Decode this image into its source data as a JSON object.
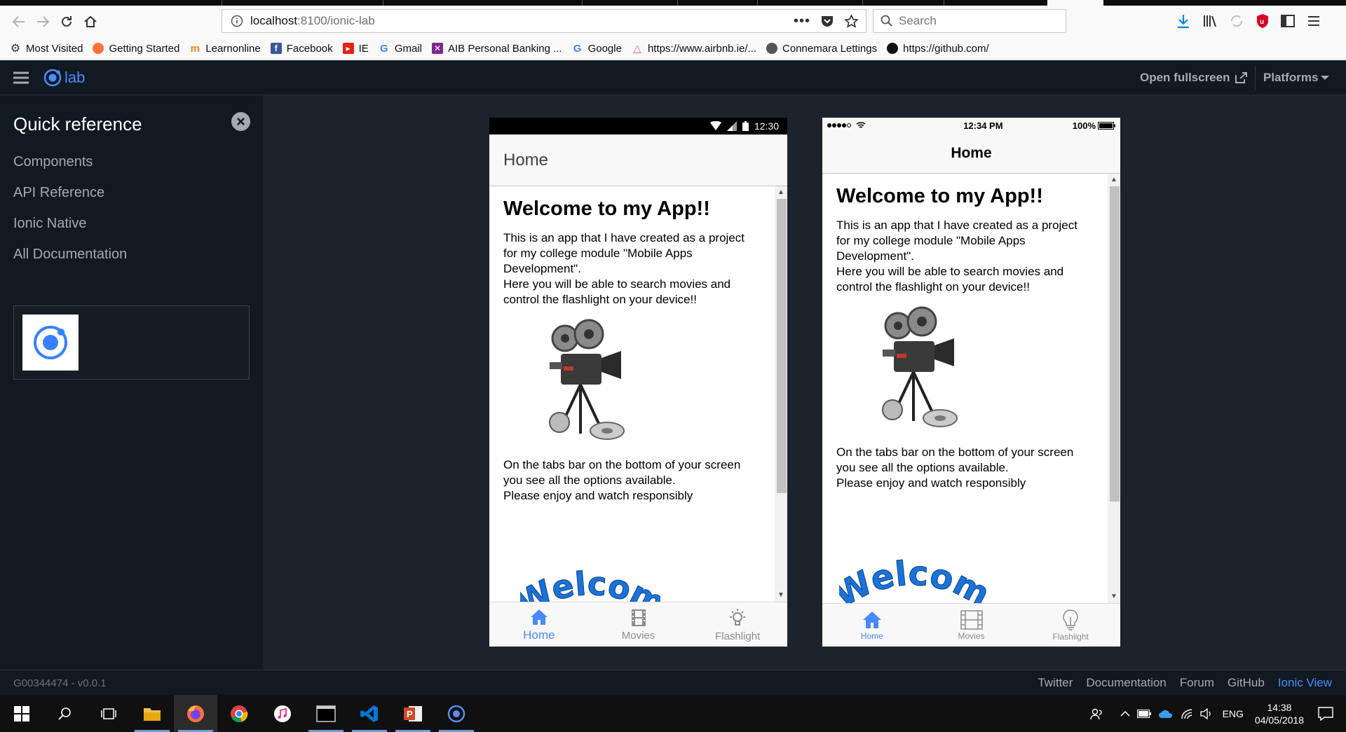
{
  "browser": {
    "url_host": "localhost",
    "url_path": ":8100/ionic-lab",
    "search_placeholder": "Search",
    "bookmarks": [
      {
        "label": "Most Visited",
        "icon": "gear-icon"
      },
      {
        "label": "Getting Started",
        "icon": "firefox-icon"
      },
      {
        "label": "Learnonline",
        "icon": "moodle-icon"
      },
      {
        "label": "Facebook",
        "icon": "facebook-icon"
      },
      {
        "label": "IE",
        "icon": "youtube-icon"
      },
      {
        "label": "Gmail",
        "icon": "google-icon"
      },
      {
        "label": "AIB Personal Banking ...",
        "icon": "aib-icon"
      },
      {
        "label": "Google",
        "icon": "google-icon"
      },
      {
        "label": "https://www.airbnb.ie/...",
        "icon": "airbnb-icon"
      },
      {
        "label": "Connemara Lettings",
        "icon": "globe-icon"
      },
      {
        "label": "https://github.com/",
        "icon": "github-icon"
      }
    ]
  },
  "lab": {
    "logo_text": "lab",
    "open_fullscreen": "Open fullscreen",
    "platforms": "Platforms",
    "accent": "#4d8dff"
  },
  "sidebar": {
    "title": "Quick reference",
    "links": [
      "Components",
      "API Reference",
      "Ionic Native",
      "All Documentation"
    ]
  },
  "footer": {
    "version": "G00344474 - v0.0.1",
    "links": [
      "Twitter",
      "Documentation",
      "Forum",
      "GitHub",
      "Ionic View"
    ]
  },
  "app": {
    "page_title": "Home",
    "heading": "Welcome to my App!!",
    "intro_lines": [
      "This is an app that I have created as a project for my college module \"Mobile Apps Development\".",
      "Here you will be able to search movies and control the flashlight on your device!!"
    ],
    "outro_lines": [
      "On the tabs bar on the bottom of your screen you see all the options available.",
      "Please enjoy and watch responsibly"
    ],
    "welcome_art_text": "Welcome",
    "tabs": [
      {
        "label": "Home",
        "icon": "home-icon"
      },
      {
        "label": "Movies",
        "icon": "film-icon"
      },
      {
        "label": "Flashlight",
        "icon": "bulb-icon"
      }
    ],
    "tab_active_color": "#488aff"
  },
  "android": {
    "time": "12:30"
  },
  "ios": {
    "time": "12:34 PM",
    "battery": "100%"
  },
  "taskbar": {
    "language": "ENG",
    "time": "14:38",
    "date": "04/05/2018"
  }
}
